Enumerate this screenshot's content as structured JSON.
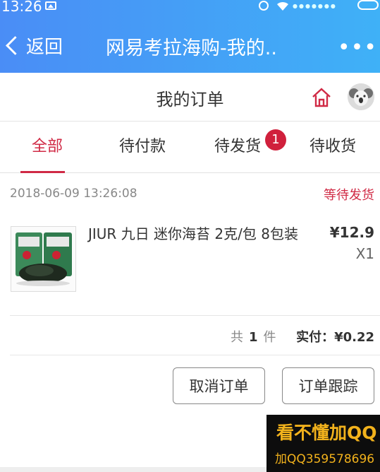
{
  "status_bar": {
    "time": "13:26"
  },
  "nav": {
    "back_label": "返回",
    "title": "网易考拉海购-我的..",
    "more": "•••"
  },
  "page": {
    "title": "我的订单"
  },
  "tabs": [
    {
      "label": "全部",
      "active": true
    },
    {
      "label": "待付款",
      "active": false
    },
    {
      "label": "待发货",
      "active": false,
      "badge": "1"
    },
    {
      "label": "待收货",
      "active": false
    }
  ],
  "order": {
    "date": "2018-06-09 13:26:08",
    "status": "等待发货",
    "item": {
      "name": "JIUR 九日 迷你海苔 2克/包 8包装",
      "price": "¥12.9",
      "qty": "X1"
    },
    "count_prefix": "共",
    "count": "1",
    "count_suffix": "件",
    "paid_label": "实付：",
    "paid_amount": "¥0.22"
  },
  "actions": {
    "cancel": "取消订单",
    "track": "订单跟踪"
  },
  "ad": {
    "line1": "看不懂加QQ",
    "line2": "加QQ359578696"
  },
  "colors": {
    "accent": "#d02a45",
    "header_start": "#4a8df6",
    "header_end": "#3fb1f7"
  }
}
